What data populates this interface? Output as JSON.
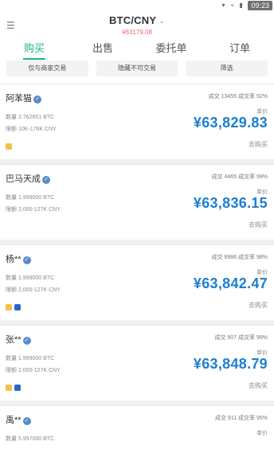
{
  "status": {
    "time": "09:23"
  },
  "header": {
    "pair": "BTC/CNY",
    "price": "¥63179.08"
  },
  "tabs": [
    {
      "label": "购买"
    },
    {
      "label": "出售"
    },
    {
      "label": "委托单"
    },
    {
      "label": "订单"
    }
  ],
  "filters": [
    {
      "label": "仅与商家交易"
    },
    {
      "label": "隐藏不可交易"
    },
    {
      "label": "筛选"
    }
  ],
  "cards": [
    {
      "name": "阿苯猫",
      "trades": "成交 13455  成交率 92%",
      "quantity": "数量 2.762651 BTC",
      "limit": "限额 10K-176K CNY",
      "unit": "单价",
      "price": "¥63,829.83",
      "action": "去购买",
      "pay": [
        "yellow"
      ]
    },
    {
      "name": "巴马天成",
      "trades": "成交 4465  成交率 99%",
      "quantity": "数量 1.999000 BTC",
      "limit": "限额 2,000-127K CNY",
      "unit": "单价",
      "price": "¥63,836.15",
      "action": "去购买",
      "pay": []
    },
    {
      "name": "杨**",
      "trades": "成交 8986  成交率 98%",
      "quantity": "数量 1.999000 BTC",
      "limit": "限额 2,000-127K CNY",
      "unit": "单价",
      "price": "¥63,842.47",
      "action": "去购买",
      "pay": [
        "yellow",
        "blue"
      ]
    },
    {
      "name": "张**",
      "trades": "成交 907  成交率 99%",
      "quantity": "数量 1.999000 BTC",
      "limit": "限额 2,000-127K CNY",
      "unit": "单价",
      "price": "¥63,848.79",
      "action": "去购买",
      "pay": [
        "yellow",
        "blue"
      ]
    },
    {
      "name": "禹**",
      "trades": "成交 911  成交率 95%",
      "quantity": "数量 5.997000 BTC",
      "limit": "",
      "unit": "单价",
      "price": "",
      "action": "",
      "pay": []
    }
  ]
}
